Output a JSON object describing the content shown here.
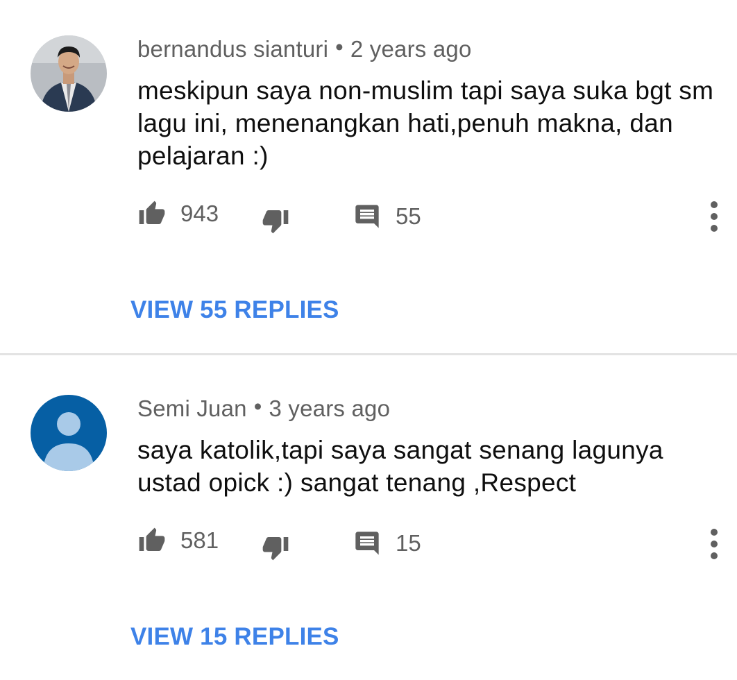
{
  "comments": [
    {
      "author": "bernandus sianturi",
      "separator": "•",
      "time": "2 years ago",
      "text": "meskipun saya non-muslim tapi saya suka bgt sm lagu ini, menenangkan hati,penuh makna, dan pelajaran :)",
      "likes": "943",
      "replies_count": "55",
      "view_replies": "VIEW 55 REPLIES",
      "avatar": "photo"
    },
    {
      "author": "Semi Juan",
      "separator": "•",
      "time": "3 years ago",
      "text": "saya katolik,tapi saya sangat senang lagunya ustad opick :) sangat tenang ,Respect",
      "likes": "581",
      "replies_count": "15",
      "view_replies": "VIEW 15 REPLIES",
      "avatar": "default-person-icon"
    }
  ],
  "icons": {
    "like": "thumbs-up-icon",
    "dislike": "thumbs-down-icon",
    "reply": "comment-icon",
    "more": "more-vertical-icon"
  },
  "colors": {
    "link": "#3e82e8",
    "meta_text": "#606060",
    "icon": "#606060",
    "default_avatar_bg": "#065fa4",
    "default_avatar_fg": "#a9cae8",
    "divider": "#e3e3e3"
  }
}
